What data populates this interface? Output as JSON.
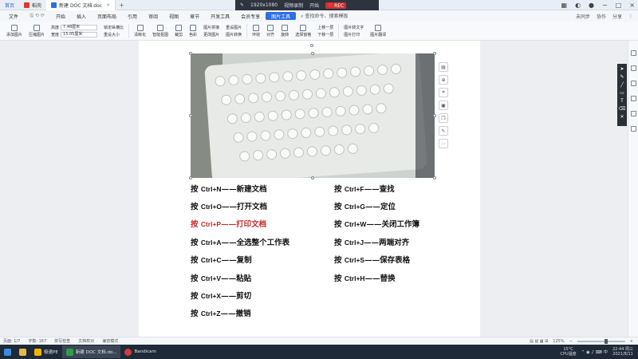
{
  "titlebar": {
    "home_tab": "首页",
    "tabs": [
      {
        "label": "稻壳",
        "color": "#d83b2a"
      },
      {
        "label": "新建 DOC 文档.doc",
        "color": "#2e6ee6"
      }
    ],
    "recorder": {
      "resolution": "1920x1080",
      "mode": "视频录制",
      "action": "开始",
      "rec": "REC"
    }
  },
  "menubar": {
    "file": "文件",
    "items": [
      "开始",
      "插入",
      "页面布局",
      "引用",
      "审阅",
      "视图",
      "章节",
      "开发工具",
      "会员专享",
      "图片工具"
    ],
    "active": "图片工具",
    "search": "查找命令、搜索模板",
    "right_items": [
      "未同步",
      "协作",
      "分享"
    ]
  },
  "ribbon": {
    "groups": [
      {
        "label": "添加图片"
      },
      {
        "label": "压缩图片"
      },
      {
        "label": "清晰化"
      },
      {
        "label": "智能抠图"
      },
      {
        "label": "裁剪"
      },
      {
        "label": "色彩"
      },
      {
        "label": "图片拼接"
      },
      {
        "label": "更改图片"
      },
      {
        "label": "重设图片"
      },
      {
        "label": "图片转换"
      },
      {
        "label": "环绕"
      },
      {
        "label": "对齐"
      },
      {
        "label": "旋转"
      },
      {
        "label": "选择窗格"
      },
      {
        "label": "上移一层"
      },
      {
        "label": "下移一层"
      },
      {
        "label": "图片转文字"
      },
      {
        "label": "图片翻译"
      },
      {
        "label": "图片打印"
      }
    ],
    "height_label": "高度",
    "height_value": "7.48厘米",
    "width_label": "宽度",
    "width_value": "15.05厘米",
    "lock_ratio": "锁定纵横比",
    "reset_size": "重设大小"
  },
  "shortcuts": {
    "left": [
      {
        "key": "Ctrl+N",
        "action": "新建文档"
      },
      {
        "key": "Ctrl+O",
        "action": "打开文档"
      },
      {
        "key": "Ctrl+P",
        "action": "打印文档"
      },
      {
        "key": "Ctrl+A",
        "action": "全选整个工作表"
      },
      {
        "key": "Ctrl+C",
        "action": "复制"
      },
      {
        "key": "Ctrl+V",
        "action": "粘贴"
      },
      {
        "key": "Ctrl+X",
        "action": "剪切"
      },
      {
        "key": "Ctrl+Z",
        "action": "撤销"
      }
    ],
    "right": [
      {
        "key": "Ctrl+F",
        "action": "查找"
      },
      {
        "key": "Ctrl+G",
        "action": "定位"
      },
      {
        "key": "Ctrl+W",
        "action": "关闭工作簿"
      },
      {
        "key": "Ctrl+J",
        "action": "两端对齐"
      },
      {
        "key": "Ctrl+S",
        "action": "保存表格"
      },
      {
        "key": "Ctrl+H",
        "action": "替换"
      }
    ],
    "prefix": "按",
    "dash": "——",
    "highlight_color": "#c62a2a"
  },
  "statusbar": {
    "page": "页面: 1/7",
    "words": "字数: 167",
    "spell": "拼写检查",
    "doc_check": "文档校对",
    "compat": "兼容模式",
    "zoom": "125%"
  },
  "taskbar": {
    "items": [
      {
        "label": "极速PE",
        "color": "#f0b400"
      },
      {
        "label": "新建 DOC 文档.do...",
        "color": "#2e9e4a"
      },
      {
        "label": "Bandicam",
        "color": "#d23b3b"
      }
    ],
    "weather": "15°C",
    "cpu": "CPU温度",
    "time": "22:44 周三",
    "date": "2021/8/11"
  }
}
